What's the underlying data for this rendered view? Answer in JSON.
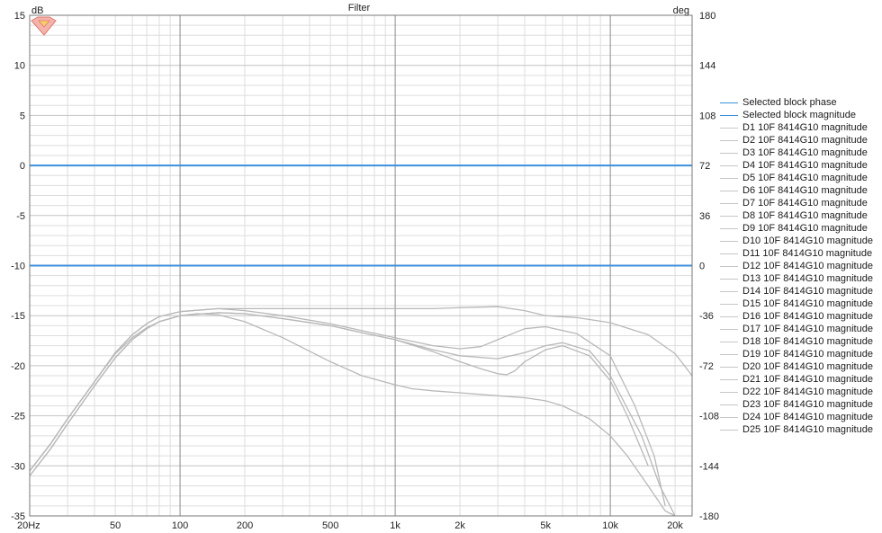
{
  "chart_data": {
    "type": "line",
    "title": "Filter",
    "y_left_unit": "dB",
    "y_right_unit": "deg",
    "x_scale": "log",
    "x_range_hz": [
      20,
      24000
    ],
    "y_left_range": [
      -35,
      15
    ],
    "y_right_range": [
      -180,
      180
    ],
    "grid": true,
    "legend_position": "right",
    "x_ticks": [
      {
        "v": 20,
        "label": "20Hz"
      },
      {
        "v": 50,
        "label": "50"
      },
      {
        "v": 100,
        "label": "100"
      },
      {
        "v": 200,
        "label": "200"
      },
      {
        "v": 500,
        "label": "500"
      },
      {
        "v": 1000,
        "label": "1k"
      },
      {
        "v": 2000,
        "label": "2k"
      },
      {
        "v": 5000,
        "label": "5k"
      },
      {
        "v": 10000,
        "label": "10k"
      },
      {
        "v": 20000,
        "label": "20k"
      }
    ],
    "y_left_ticks": [
      15,
      10,
      5,
      0,
      -5,
      -10,
      -15,
      -20,
      -25,
      -30,
      -35
    ],
    "y_right_ticks": [
      180,
      144,
      108,
      72,
      36,
      0,
      -36,
      -72,
      -108,
      -144,
      -180
    ],
    "colors": {
      "selected": "#3d8fdc",
      "curve": "#b8b8b8",
      "grid_major": "#8a8a8a",
      "grid_minor": "#dddddd",
      "swatch": "#c6c6c6"
    },
    "series": [
      {
        "name": "Selected block phase",
        "axis": "right",
        "style": "selected",
        "x": [
          20,
          24000
        ],
        "y": [
          0,
          0
        ]
      },
      {
        "name": "Selected block magnitude",
        "axis": "left",
        "style": "selected",
        "x": [
          20,
          24000
        ],
        "y": [
          0,
          0
        ]
      },
      {
        "name": "D1 10F 8414G10 magnitude",
        "axis": "left",
        "style": "curve",
        "x": [
          20,
          25,
          30,
          40,
          50,
          60,
          70,
          80,
          100,
          150,
          200,
          300,
          500,
          700,
          1000,
          1500,
          2000,
          3000,
          4000,
          5000,
          7000,
          10000,
          15000,
          20000,
          24000
        ],
        "y": [
          -30.5,
          -27.8,
          -25.3,
          -21.6,
          -18.7,
          -16.9,
          -15.8,
          -15.1,
          -14.6,
          -14.3,
          -14.3,
          -14.3,
          -14.3,
          -14.3,
          -14.3,
          -14.3,
          -14.2,
          -14.1,
          -14.5,
          -15.0,
          -15.2,
          -15.7,
          -16.9,
          -18.8,
          -21.0
        ]
      },
      {
        "name": "D2 10F 8414G10 magnitude",
        "axis": "left",
        "style": "curve",
        "x": [
          20,
          25,
          30,
          40,
          50,
          60,
          70,
          80,
          100,
          150,
          200,
          300,
          500,
          700,
          1000,
          1500,
          2000,
          2500,
          3000,
          3500,
          4000,
          5000,
          7000,
          10000,
          13000,
          16000,
          18000
        ],
        "y": [
          -30.5,
          -27.8,
          -25.3,
          -21.6,
          -18.7,
          -16.9,
          -15.8,
          -15.1,
          -14.6,
          -14.3,
          -14.5,
          -15.0,
          -15.8,
          -16.5,
          -17.2,
          -18.0,
          -18.3,
          -18.1,
          -17.4,
          -16.8,
          -16.3,
          -16.1,
          -16.8,
          -19.0,
          -24.0,
          -29.0,
          -34.0
        ]
      },
      {
        "name": "D3 10F 8414G10 magnitude",
        "axis": "left",
        "style": "curve",
        "x": [
          20,
          25,
          30,
          40,
          50,
          60,
          70,
          80,
          100,
          150,
          200,
          300,
          500,
          700,
          1000,
          1500,
          2000,
          3000,
          4000,
          5000,
          6000,
          8000,
          10000,
          14000,
          17000,
          20000
        ],
        "y": [
          -31.0,
          -28.3,
          -25.8,
          -22.0,
          -19.2,
          -17.4,
          -16.3,
          -15.6,
          -15.0,
          -14.7,
          -14.8,
          -15.3,
          -16.0,
          -16.7,
          -17.4,
          -18.4,
          -19.0,
          -19.3,
          -18.7,
          -18.0,
          -17.7,
          -18.5,
          -21.0,
          -27.0,
          -32.0,
          -35.0
        ]
      },
      {
        "name": "D4 10F 8414G10 magnitude",
        "axis": "left",
        "style": "curve",
        "x": [
          20,
          25,
          30,
          40,
          50,
          60,
          70,
          80,
          100,
          150,
          200,
          300,
          500,
          700,
          1000,
          1500,
          2000,
          2500,
          3000,
          3300,
          3600,
          4000,
          5000,
          6000,
          8000,
          10000,
          12000,
          15000
        ],
        "y": [
          -31.0,
          -28.3,
          -25.8,
          -22.0,
          -19.2,
          -17.4,
          -16.3,
          -15.6,
          -15.0,
          -14.7,
          -14.8,
          -15.3,
          -16.0,
          -16.7,
          -17.4,
          -18.6,
          -19.6,
          -20.3,
          -20.8,
          -20.9,
          -20.5,
          -19.6,
          -18.4,
          -18.0,
          -19.0,
          -21.5,
          -25.0,
          -30.0
        ]
      },
      {
        "name": "D5 10F 8414G10 magnitude",
        "axis": "left",
        "style": "curve",
        "x": [
          20,
          25,
          30,
          40,
          50,
          60,
          70,
          80,
          100,
          120,
          150,
          200,
          300,
          500,
          700,
          1000,
          1200,
          1500,
          2000,
          3000,
          4000,
          5000,
          6000,
          8000,
          10000,
          12000,
          15000,
          18000,
          20000
        ],
        "y": [
          -30.5,
          -27.8,
          -25.3,
          -21.6,
          -18.8,
          -17.2,
          -16.2,
          -15.6,
          -15.0,
          -14.8,
          -14.9,
          -15.6,
          -17.2,
          -19.6,
          -21.0,
          -21.9,
          -22.3,
          -22.5,
          -22.7,
          -23.0,
          -23.2,
          -23.5,
          -24.0,
          -25.3,
          -27.0,
          -29.0,
          -32.0,
          -34.5,
          -35.0
        ]
      },
      {
        "name": "D6 10F 8414G10 magnitude",
        "axis": "left",
        "style": "none"
      },
      {
        "name": "D7 10F 8414G10 magnitude",
        "axis": "left",
        "style": "none"
      },
      {
        "name": "D8 10F 8414G10 magnitude",
        "axis": "left",
        "style": "none"
      },
      {
        "name": "D9 10F 8414G10 magnitude",
        "axis": "left",
        "style": "none"
      },
      {
        "name": "D10 10F 8414G10 magnitude",
        "axis": "left",
        "style": "none"
      },
      {
        "name": "D11 10F 8414G10 magnitude",
        "axis": "left",
        "style": "none"
      },
      {
        "name": "D12 10F 8414G10 magnitude",
        "axis": "left",
        "style": "none"
      },
      {
        "name": "D13 10F 8414G10 magnitude",
        "axis": "left",
        "style": "none"
      },
      {
        "name": "D14 10F 8414G10 magnitude",
        "axis": "left",
        "style": "none"
      },
      {
        "name": "D15 10F 8414G10 magnitude",
        "axis": "left",
        "style": "none"
      },
      {
        "name": "D16 10F 8414G10 magnitude",
        "axis": "left",
        "style": "none"
      },
      {
        "name": "D17 10F 8414G10 magnitude",
        "axis": "left",
        "style": "none"
      },
      {
        "name": "D18 10F 8414G10 magnitude",
        "axis": "left",
        "style": "none"
      },
      {
        "name": "D19 10F 8414G10 magnitude",
        "axis": "left",
        "style": "none"
      },
      {
        "name": "D20 10F 8414G10 magnitude",
        "axis": "left",
        "style": "none"
      },
      {
        "name": "D21 10F 8414G10 magnitude",
        "axis": "left",
        "style": "none"
      },
      {
        "name": "D22 10F 8414G10 magnitude",
        "axis": "left",
        "style": "none"
      },
      {
        "name": "D23 10F 8414G10 magnitude",
        "axis": "left",
        "style": "none"
      },
      {
        "name": "D24 10F 8414G10 magnitude",
        "axis": "left",
        "style": "none"
      },
      {
        "name": "D25 10F 8414G10 magnitude",
        "axis": "left",
        "style": "none"
      }
    ]
  }
}
